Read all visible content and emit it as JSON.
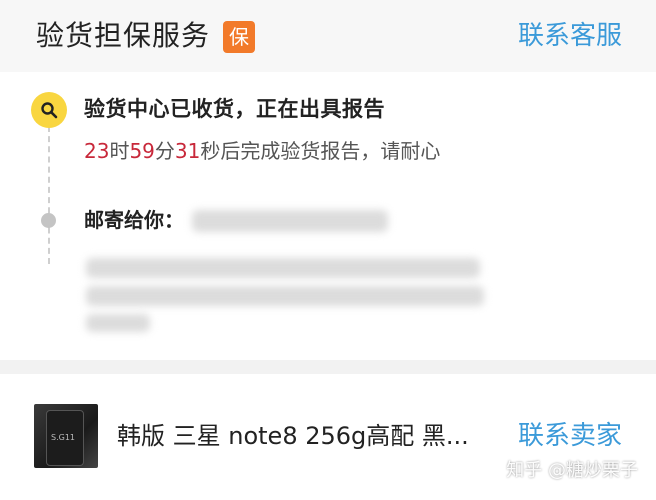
{
  "header": {
    "title": "验货担保服务",
    "badge": "保",
    "contact_service": "联系客服"
  },
  "timeline": {
    "status_title": "验货中心已收货，正在出具报告",
    "countdown": {
      "hours": "23",
      "hour_unit": "时",
      "minutes": "59",
      "minute_unit": "分",
      "seconds": "31",
      "suffix": "秒后完成验货报告，请耐心"
    },
    "mail_label": "邮寄给你："
  },
  "product": {
    "title": "韩版 三星 note8 256g高配 黑...",
    "contact_seller": "联系卖家",
    "thumb_text": "S.G11"
  },
  "watermark": "知乎 @糖炒栗子",
  "colors": {
    "accent_blue": "#3b9ad9",
    "badge_orange": "#f27a2a",
    "countdown_red": "#c8283a",
    "search_yellow": "#f9d640"
  }
}
